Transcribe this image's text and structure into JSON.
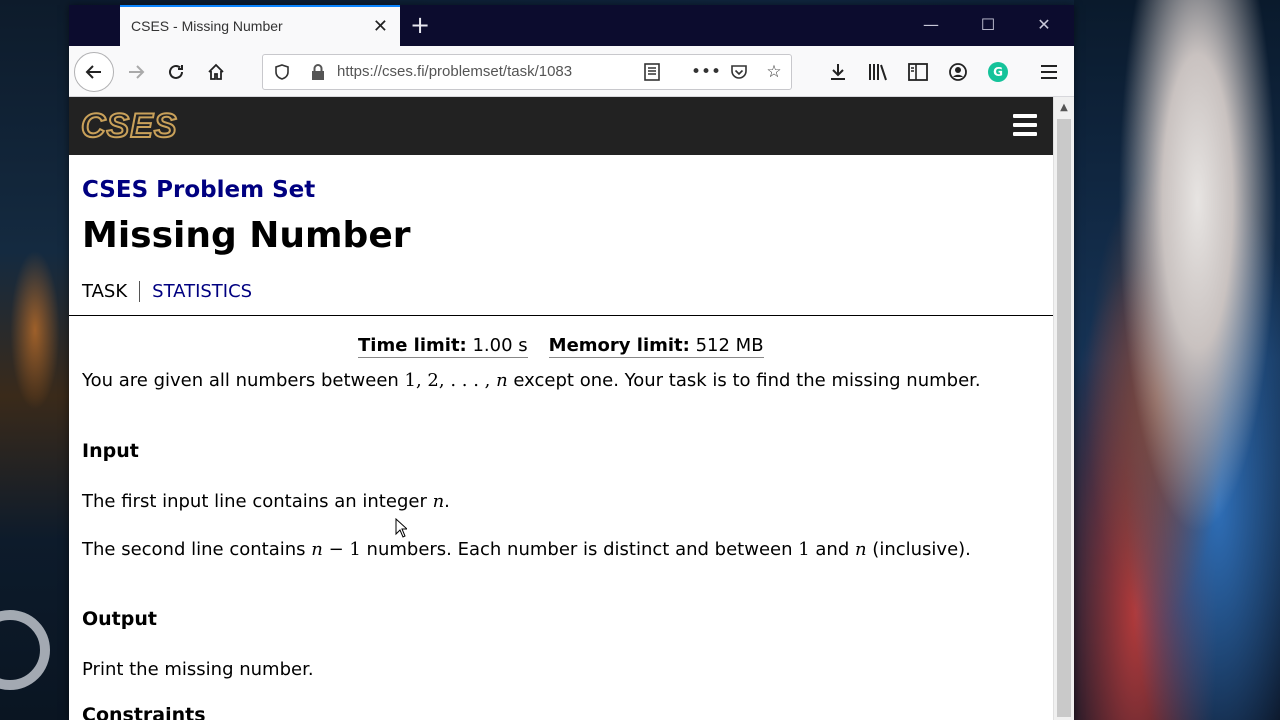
{
  "browser": {
    "tab_title": "CSES - Missing Number",
    "tab_close": "✕",
    "new_tab": "+",
    "url": "https://cses.fi/problemset/task/1083",
    "window_controls": {
      "minimize": "—",
      "maximize": "☐",
      "close": "✕"
    }
  },
  "site": {
    "logo": "CSES",
    "breadcrumb": "CSES Problem Set",
    "title": "Missing Number",
    "nav": {
      "task": "TASK",
      "statistics": "STATISTICS"
    }
  },
  "limits": {
    "time_label": "Time limit:",
    "time_value": "1.00 s",
    "memory_label": "Memory limit:",
    "memory_value": "512 MB"
  },
  "statement": {
    "intro_a": "You are given all numbers between ",
    "intro_math": "1, 2, . . . , ",
    "intro_n": "n",
    "intro_b": " except one. Your task is to find the missing number.",
    "input_title": "Input",
    "input_line1_a": "The first input line contains an integer ",
    "input_line1_n": "n",
    "input_line1_b": ".",
    "input_line2_a": "The second line contains ",
    "input_line2_n": "n",
    "input_line2_minus": " − 1",
    "input_line2_b": " numbers. Each number is distinct and between ",
    "input_line2_one": "1",
    "input_line2_c": " and ",
    "input_line2_n2": "n",
    "input_line2_d": " (inclusive).",
    "output_title": "Output",
    "output_text": "Print the missing number.",
    "constraints_title": "Constraints"
  },
  "colors": {
    "accent_blue": "#000080",
    "header_bg": "#222222",
    "logo_gold": "#c9a15a",
    "titlebar": "#0c0c2e",
    "tab_highlight": "#0a84ff"
  },
  "icons": {
    "back": "back-arrow-icon",
    "forward": "forward-arrow-icon",
    "reload": "reload-icon",
    "home": "home-icon",
    "shield": "tracking-shield-icon",
    "lock": "lock-icon",
    "reader": "reader-view-icon",
    "more": "more-icon",
    "pocket": "pocket-icon",
    "bookmark": "star-icon",
    "download": "download-icon",
    "library": "library-icon",
    "sidebar": "sidebar-icon",
    "account": "account-icon",
    "grammarly": "grammarly-icon",
    "menu": "hamburger-menu-icon"
  }
}
